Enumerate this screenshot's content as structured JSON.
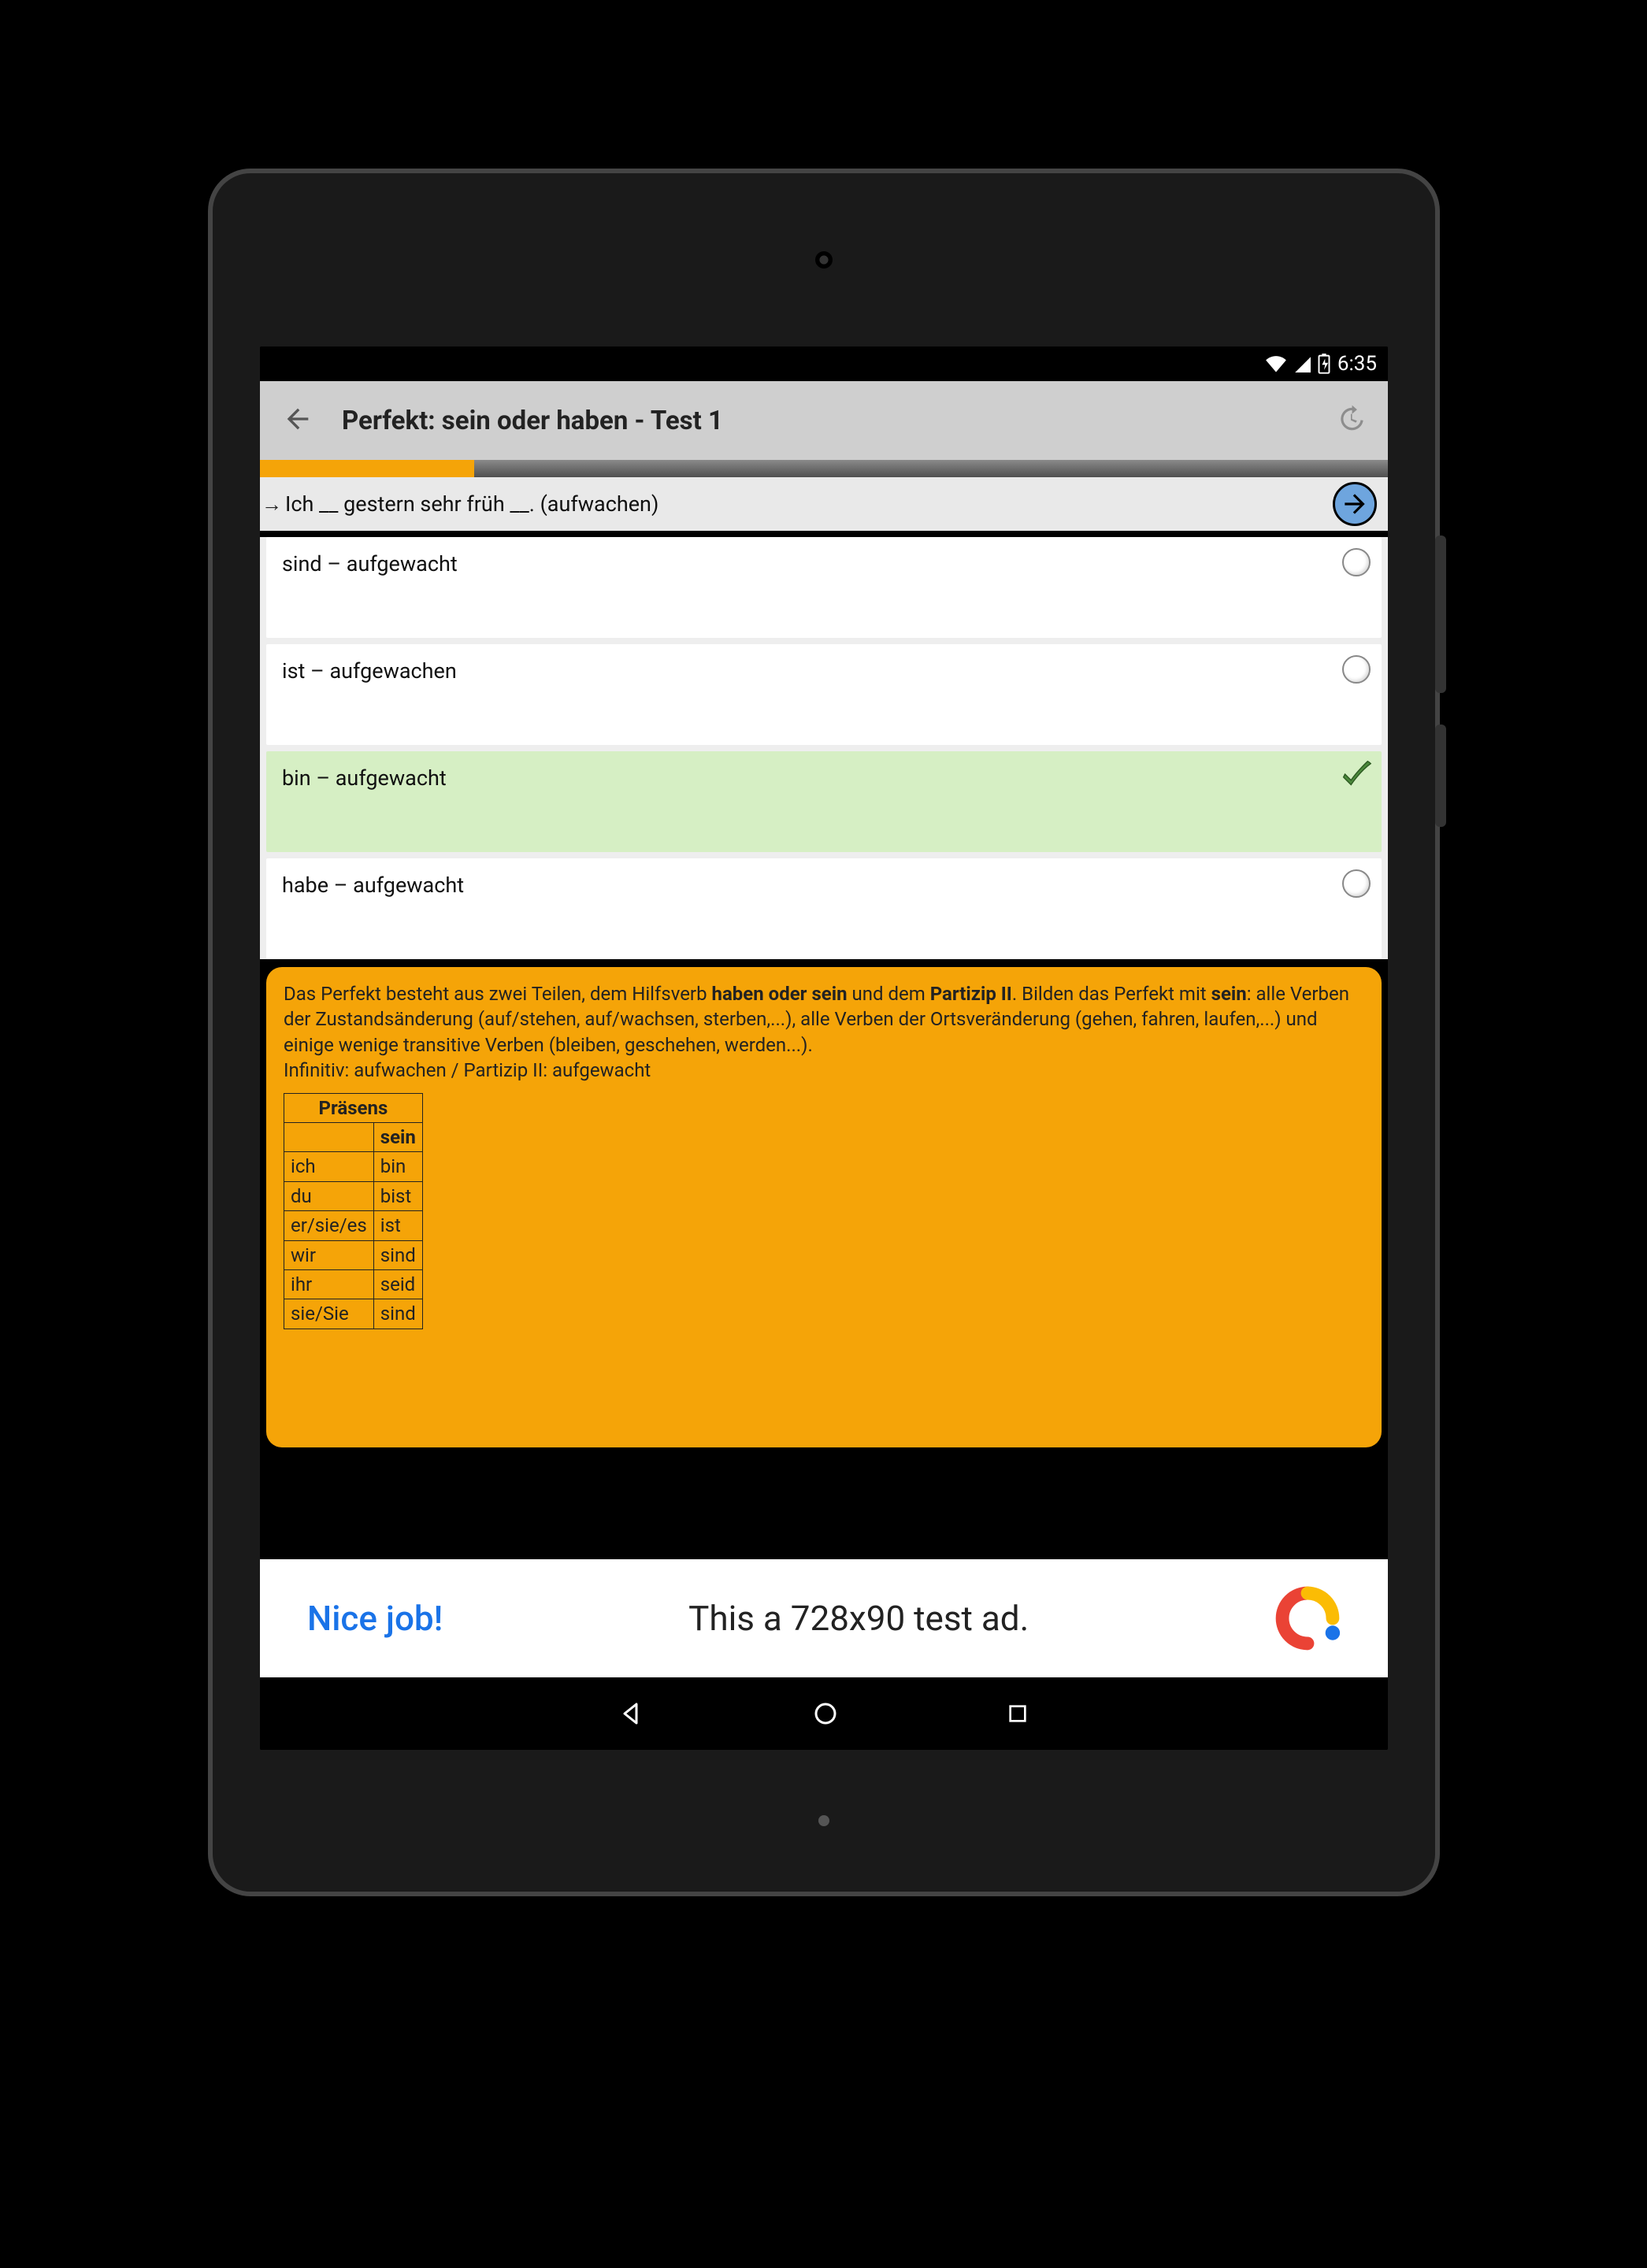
{
  "statusbar": {
    "time": "6:35"
  },
  "toolbar": {
    "title": "Perfekt: sein oder haben - Test 1"
  },
  "progress": {
    "percent": 19
  },
  "question": {
    "text": "Ich __ gestern sehr früh __.  (aufwachen)"
  },
  "answers": [
    {
      "label": "sind – aufgewacht",
      "state": "neutral"
    },
    {
      "label": "ist – aufgewachen",
      "state": "neutral"
    },
    {
      "label": "bin – aufgewacht",
      "state": "correct"
    },
    {
      "label": "habe – aufgewacht",
      "state": "neutral"
    }
  ],
  "explain": {
    "p1a": "Das Perfekt besteht aus zwei Teilen, dem Hilfsverb ",
    "p1b": "haben oder sein",
    "p1c": " und dem ",
    "p1d": "Partizip II",
    "p1e": ". Bilden das Perfekt mit ",
    "p1f": "sein",
    "p1g": ": alle Verben der Zustandsänderung (auf/stehen, auf/wachsen, sterben,...), alle Verben der Ortsveränderung (gehen, fahren, laufen,...) und einige wenige transitive Verben (bleiben, geschehen, werden...).",
    "p2": "Infinitiv: aufwachen / Partizip II: aufgewacht",
    "table": {
      "head": "Präsens",
      "sub": "sein",
      "rows": [
        {
          "p": "ich",
          "f": "bin"
        },
        {
          "p": "du",
          "f": "bist"
        },
        {
          "p": "er/sie/es",
          "f": "ist"
        },
        {
          "p": "wir",
          "f": "sind"
        },
        {
          "p": "ihr",
          "f": "seid"
        },
        {
          "p": "sie/Sie",
          "f": "sind"
        }
      ]
    }
  },
  "ad": {
    "nice": "Nice job!",
    "text": "This a 728x90 test ad."
  }
}
